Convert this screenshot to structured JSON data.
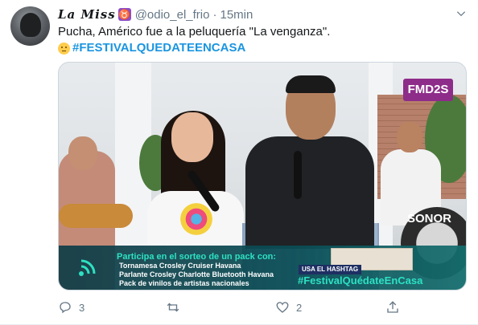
{
  "tweet": {
    "display_name": "La Miss",
    "badge_glyph": "♉",
    "handle": "@odio_el_frio",
    "separator": "·",
    "time": "15min",
    "text_line1": "Pucha, Américo fue a la peluquería \"La venganza\".",
    "hashtag": "#FESTIVALQUEDATEENCASA"
  },
  "media": {
    "channel_logo": "FMD2S",
    "drum_brand": "SONOR",
    "banner_heading": "Participa en el sorteo de un pack con:",
    "banner_lines": [
      "Tornamesa Crosley Cruiser Havana",
      "Parlante Crosley Charlotte Bluetooth Havana",
      "Pack de vinilos de artistas nacionales"
    ],
    "usa_label": "USA EL HASHTAG",
    "banner_hashtag": "#FestivalQuédateEnCasa"
  },
  "actions": {
    "reply_count": "3",
    "retweet_count": "",
    "like_count": "2"
  },
  "colors": {
    "link": "#1b95e0",
    "secondary_text": "#657786",
    "banner_accent": "#2de1c2"
  },
  "icons": [
    "chevron-down-icon",
    "reply-icon",
    "retweet-icon",
    "like-icon",
    "share-icon",
    "broadcast-icon"
  ]
}
